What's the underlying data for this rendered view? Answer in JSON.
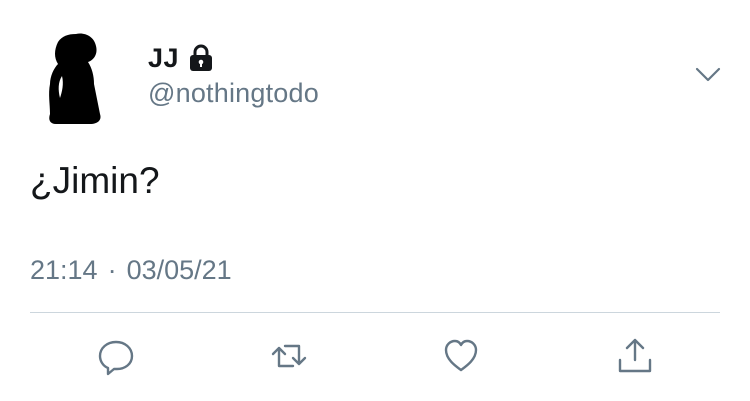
{
  "tweet": {
    "display_name": "JJ",
    "handle": "@nothingtodo",
    "text": "¿Jimin?",
    "time": "21:14",
    "separator": "·",
    "date": "03/05/21"
  },
  "icons": {
    "protected": "lock-icon",
    "menu": "chevron-down-icon",
    "actions": [
      "reply-icon",
      "retweet-icon",
      "like-icon",
      "share-icon"
    ]
  },
  "colors": {
    "primary_text": "#14171a",
    "secondary_text": "#657786",
    "icon": "#657786",
    "divider": "#ccd6dd"
  }
}
